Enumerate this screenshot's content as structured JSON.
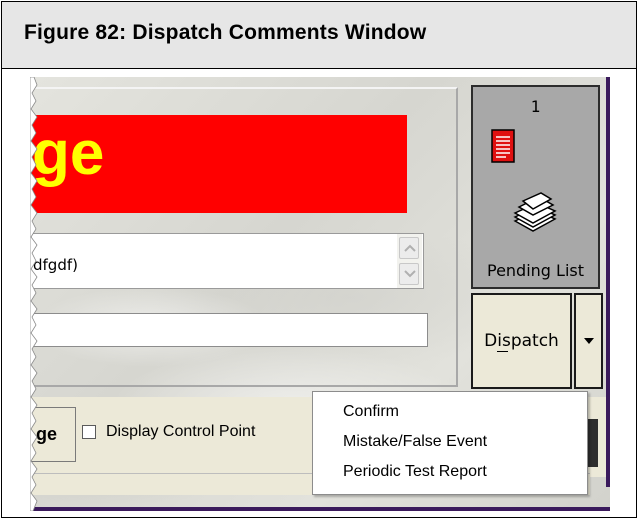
{
  "figure": {
    "title": "Figure 82:  Dispatch Comments Window"
  },
  "banner": {
    "text": "ge",
    "background": "#ff0000",
    "text_color": "#ffff00"
  },
  "comments_area": {
    "value": "dfgdf)"
  },
  "input_field": {
    "value": ""
  },
  "pending_list": {
    "count": "1",
    "label": "Pending List",
    "icons": [
      "document-red-icon",
      "paper-stack-icon"
    ]
  },
  "dispatch_button": {
    "label": "Dispatch",
    "dropdown_icon": "chevron-down-icon"
  },
  "tab": {
    "label": "ge"
  },
  "display_control_point": {
    "label": "Display Control Point",
    "checked": false
  },
  "dispatch_menu": {
    "items": [
      {
        "label": "Confirm"
      },
      {
        "label": "Mistake/False Event"
      },
      {
        "label": "Periodic Test Report"
      }
    ]
  },
  "colors": {
    "frame_accent": "#3a1a5c",
    "button_face": "#ece9d8",
    "pending_bg": "#a8a8a8"
  }
}
